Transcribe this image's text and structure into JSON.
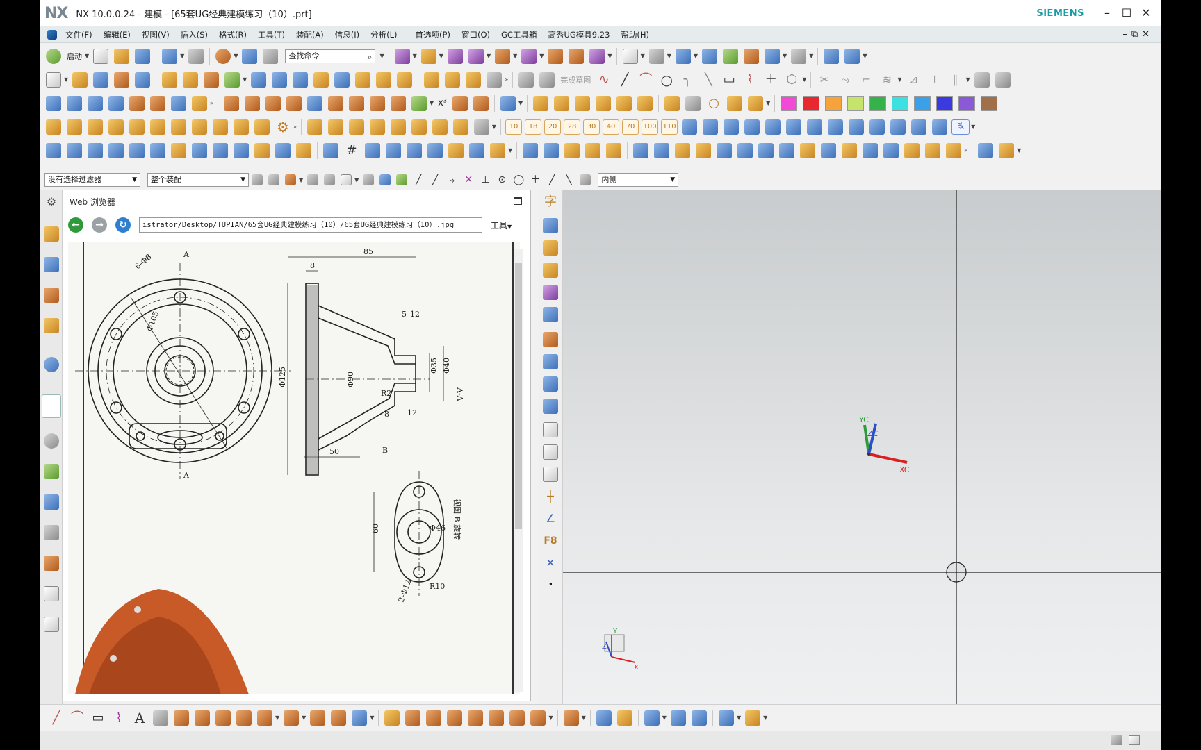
{
  "app": {
    "logo": "NX",
    "title": "NX 10.0.0.24 - 建模 - [65套UG经典建模练习（10）.prt]",
    "brand": "SIEMENS",
    "brand_color": "#1a9ca8"
  },
  "menu": {
    "items": [
      "文件(F)",
      "编辑(E)",
      "视图(V)",
      "插入(S)",
      "格式(R)",
      "工具(T)",
      "装配(A)",
      "信息(I)",
      "分析(L)",
      "首选项(P)",
      "窗口(O)",
      "GC工具箱",
      "高秀UG模具9.23",
      "帮助(H)"
    ]
  },
  "toolbar": {
    "start_label": "启动",
    "search_placeholder": "查找命令",
    "finish_sketch_label": "完成草图",
    "layer_buttons": [
      "10",
      "18",
      "20",
      "28",
      "30",
      "40",
      "70",
      "100",
      "110"
    ],
    "change_label": "改",
    "superscript_label": "x³",
    "colors": [
      "#f04ad6",
      "#e8282e",
      "#f5a33a",
      "#c4e46b",
      "#35b34a",
      "#3de0e0",
      "#3aa0e8",
      "#3a3ae0",
      "#8a5ad6",
      "#a0704a"
    ]
  },
  "filters": {
    "selection_filter": "没有选择过滤器",
    "scope": "整个装配",
    "snap_mode": "内侧"
  },
  "browser": {
    "title": "Web 浏览器",
    "url": "istrator/Desktop/TUPIAN/65套UG经典建模练习（10）/65套UG经典建模练习（10）.jpg",
    "tools_label": "工具"
  },
  "drawing": {
    "dims": [
      "85",
      "8",
      "5",
      "12",
      "6-Φ8",
      "Φ105",
      "Φ125",
      "Φ90",
      "Φ40",
      "Φ35",
      "R2",
      "12",
      "8",
      "50",
      "60",
      "Φ46",
      "R10",
      "2-Φ12",
      "B"
    ],
    "section_label": "A-A",
    "view_label": "视图 B 旋转",
    "cut_marks": [
      "A",
      "A",
      "A"
    ]
  },
  "viewport": {
    "triad_x": "XC",
    "triad_y": "YC",
    "triad_z": "ZC",
    "mini_x": "X",
    "mini_y": "Y",
    "mini_z": "Z"
  },
  "vtool": {
    "text_icon": "字",
    "f8_label": "F8"
  }
}
